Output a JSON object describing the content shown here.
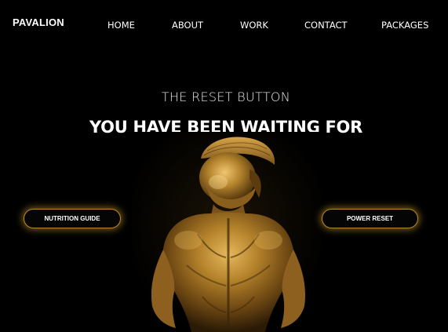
{
  "brand": {
    "logo_text": "PAVALION"
  },
  "nav": {
    "items": [
      {
        "label": "HOME"
      },
      {
        "label": "ABOUT"
      },
      {
        "label": "WORK"
      },
      {
        "label": "CONTACT"
      },
      {
        "label": "PACKAGES"
      }
    ]
  },
  "hero": {
    "subtitle": "THE RESET BUTTON",
    "title": "YOU HAVE BEEN WAITING FOR",
    "image_icon": "spartan-warrior-back-image"
  },
  "cta": {
    "left_label": "NUTRITION GUIDE",
    "right_label": "POWER RESET"
  },
  "colors": {
    "background": "#000000",
    "text": "#ffffff",
    "accent_gold": "#c9962f"
  }
}
